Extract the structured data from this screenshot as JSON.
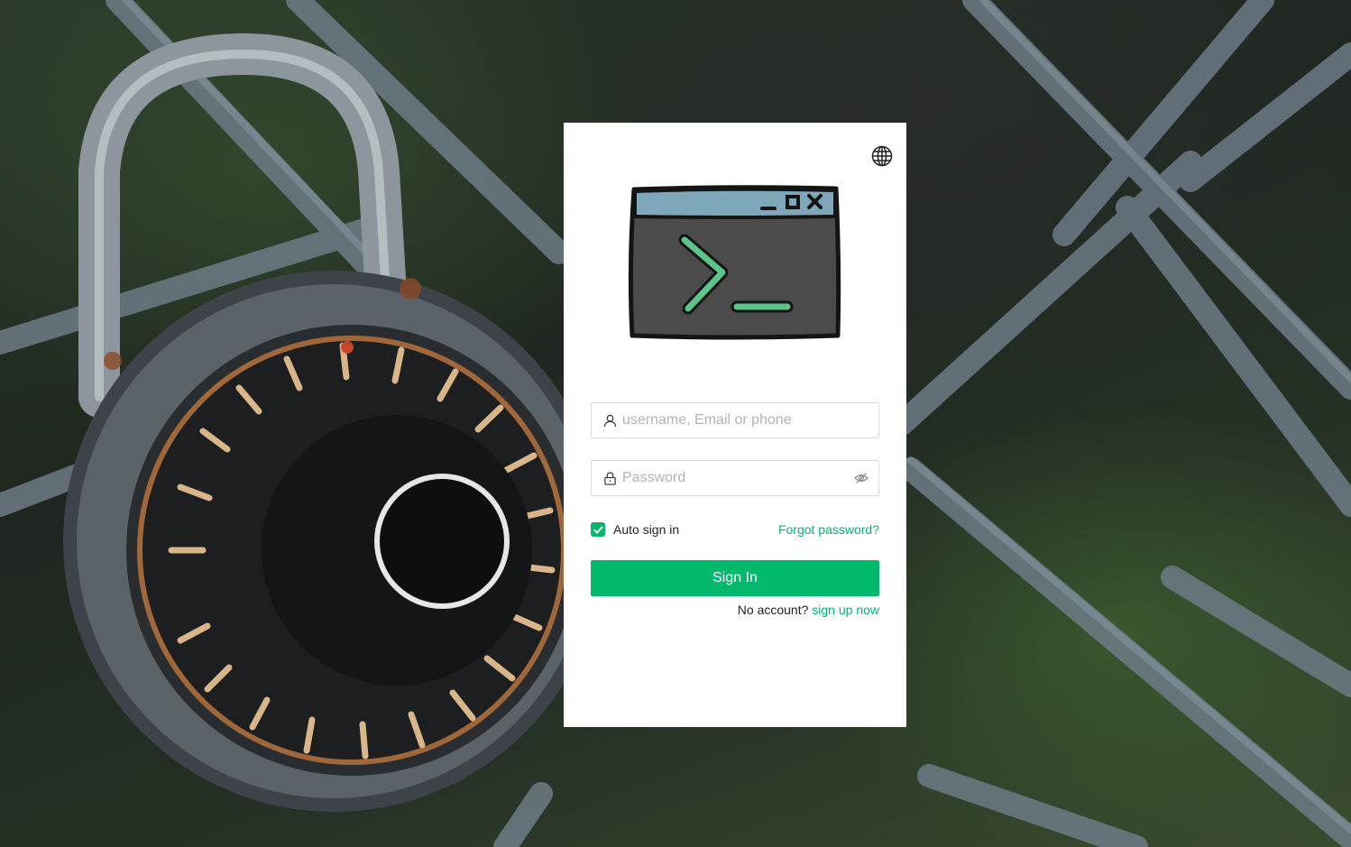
{
  "background": {
    "description_icon": "combination-padlock-on-chain-link-fence"
  },
  "header": {
    "language_icon": "globe-icon"
  },
  "logo": {
    "icon": "terminal-window-icon",
    "colors": {
      "title_bar": "#7aa6bb",
      "body": "#4a4a4a",
      "prompt": "#5cc38a"
    }
  },
  "form": {
    "username": {
      "placeholder": "username, Email or phone",
      "value": "",
      "icon": "user-icon"
    },
    "password": {
      "placeholder": "Password",
      "value": "",
      "icon": "lock-icon",
      "toggle_icon": "eye-hidden-icon"
    },
    "auto_sign_in": {
      "label": "Auto sign in",
      "checked": true
    },
    "forgot_password": "Forgot password?",
    "submit_label": "Sign In",
    "no_account_text": "No account?",
    "signup_link": "sign up now"
  },
  "colors": {
    "accent": "#00b96b"
  }
}
